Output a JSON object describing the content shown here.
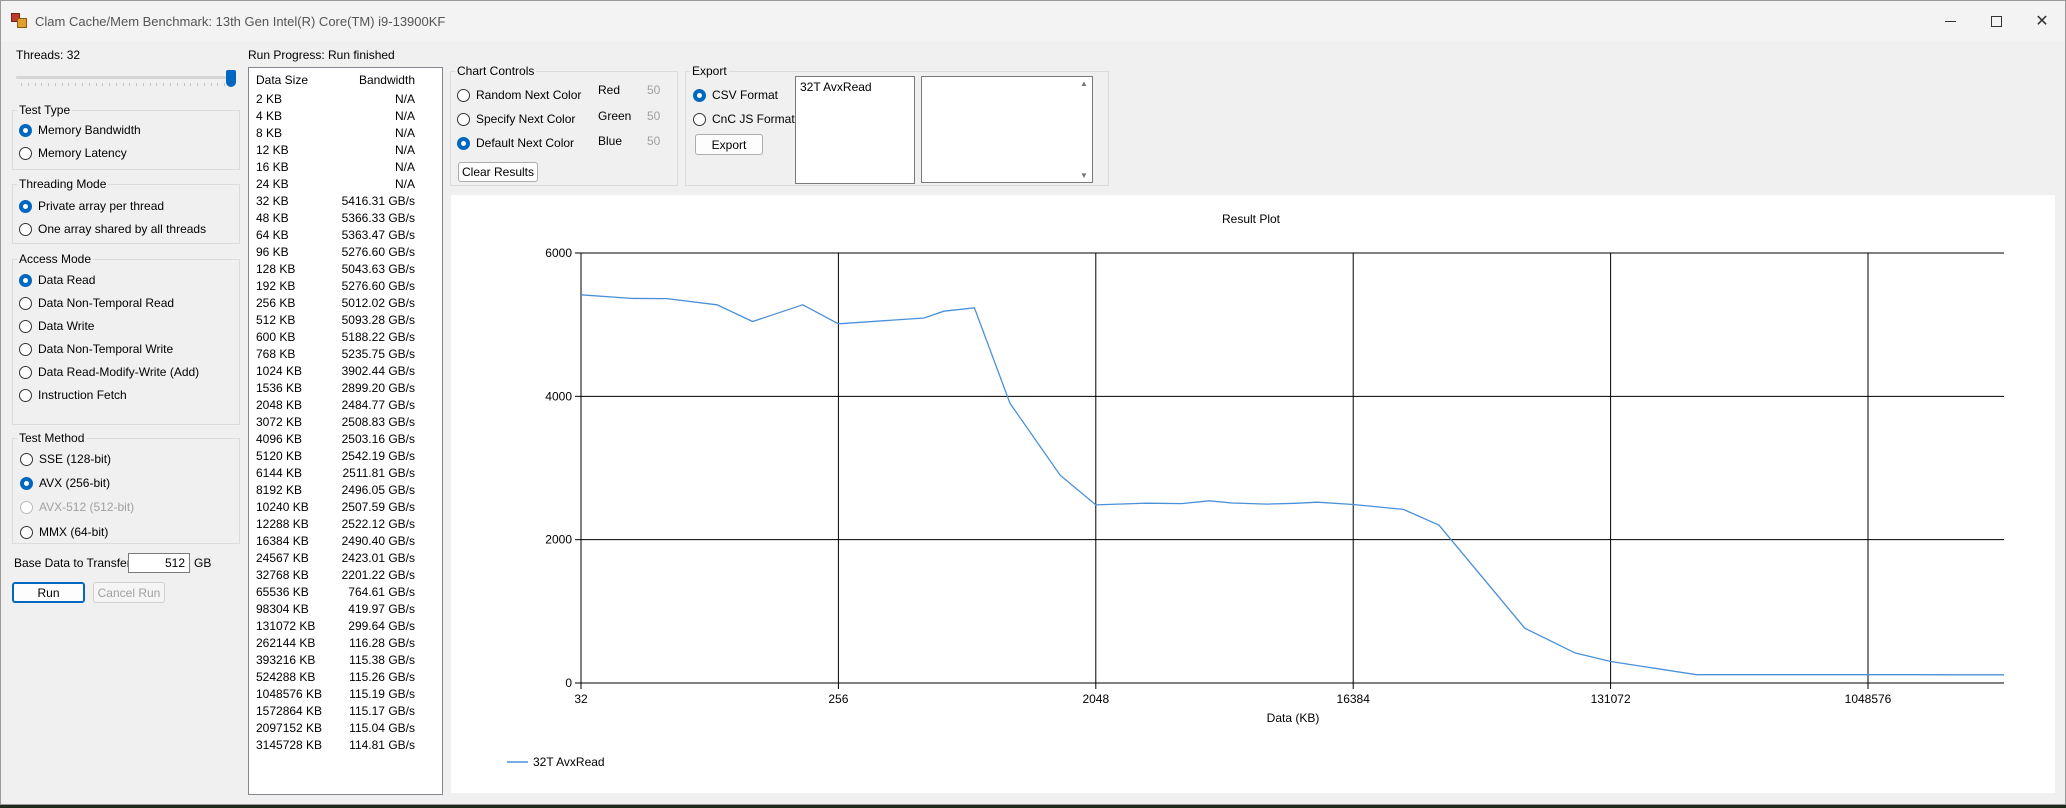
{
  "window": {
    "title": "Clam Cache/Mem Benchmark: 13th Gen Intel(R) Core(TM) i9-13900KF"
  },
  "threads": {
    "label": "Threads: 32",
    "slider_fraction": 1.0
  },
  "test_type": {
    "title": "Test Type",
    "options": [
      "Memory Bandwidth",
      "Memory Latency"
    ],
    "selected": 0
  },
  "threading_mode": {
    "title": "Threading Mode",
    "options": [
      "Private array per thread",
      "One array shared by all threads"
    ],
    "selected": 0
  },
  "access_mode": {
    "title": "Access Mode",
    "options": [
      "Data Read",
      "Data Non-Temporal Read",
      "Data Write",
      "Data Non-Temporal Write",
      "Data Read-Modify-Write (Add)",
      "Instruction Fetch"
    ],
    "selected": 0
  },
  "test_method": {
    "title": "Test Method",
    "options": [
      "SSE (128-bit)",
      "AVX (256-bit)",
      "AVX-512 (512-bit)",
      "MMX (64-bit)"
    ],
    "selected": 1,
    "disabled": 2
  },
  "base_data": {
    "label": "Base Data to Transfer:",
    "value": "512",
    "unit": "GB"
  },
  "buttons": {
    "run": "Run",
    "cancel": "Cancel Run",
    "clear": "Clear Results",
    "export": "Export"
  },
  "progress": {
    "label": "Run Progress:",
    "status": "Run finished"
  },
  "results": {
    "headers": [
      "Data Size",
      "Bandwidth"
    ],
    "rows": [
      [
        "2 KB",
        "N/A"
      ],
      [
        "4 KB",
        "N/A"
      ],
      [
        "8 KB",
        "N/A"
      ],
      [
        "12 KB",
        "N/A"
      ],
      [
        "16 KB",
        "N/A"
      ],
      [
        "24 KB",
        "N/A"
      ],
      [
        "32 KB",
        "5416.31 GB/s"
      ],
      [
        "48 KB",
        "5366.33 GB/s"
      ],
      [
        "64 KB",
        "5363.47 GB/s"
      ],
      [
        "96 KB",
        "5276.60 GB/s"
      ],
      [
        "128 KB",
        "5043.63 GB/s"
      ],
      [
        "192 KB",
        "5276.60 GB/s"
      ],
      [
        "256 KB",
        "5012.02 GB/s"
      ],
      [
        "512 KB",
        "5093.28 GB/s"
      ],
      [
        "600 KB",
        "5188.22 GB/s"
      ],
      [
        "768 KB",
        "5235.75 GB/s"
      ],
      [
        "1024 KB",
        "3902.44 GB/s"
      ],
      [
        "1536 KB",
        "2899.20 GB/s"
      ],
      [
        "2048 KB",
        "2484.77 GB/s"
      ],
      [
        "3072 KB",
        "2508.83 GB/s"
      ],
      [
        "4096 KB",
        "2503.16 GB/s"
      ],
      [
        "5120 KB",
        "2542.19 GB/s"
      ],
      [
        "6144 KB",
        "2511.81 GB/s"
      ],
      [
        "8192 KB",
        "2496.05 GB/s"
      ],
      [
        "10240 KB",
        "2507.59 GB/s"
      ],
      [
        "12288 KB",
        "2522.12 GB/s"
      ],
      [
        "16384 KB",
        "2490.40 GB/s"
      ],
      [
        "24567 KB",
        "2423.01 GB/s"
      ],
      [
        "32768 KB",
        "2201.22 GB/s"
      ],
      [
        "65536 KB",
        "764.61 GB/s"
      ],
      [
        "98304 KB",
        "419.97 GB/s"
      ],
      [
        "131072 KB",
        "299.64 GB/s"
      ],
      [
        "262144 KB",
        "116.28 GB/s"
      ],
      [
        "393216 KB",
        "115.38 GB/s"
      ],
      [
        "524288 KB",
        "115.26 GB/s"
      ],
      [
        "1048576 KB",
        "115.19 GB/s"
      ],
      [
        "1572864 KB",
        "115.17 GB/s"
      ],
      [
        "2097152 KB",
        "115.04 GB/s"
      ],
      [
        "3145728 KB",
        "114.81 GB/s"
      ]
    ]
  },
  "chart_controls": {
    "title": "Chart Controls",
    "options": [
      "Random Next Color",
      "Specify Next Color",
      "Default Next Color"
    ],
    "selected": 2,
    "rgb": [
      {
        "label": "Red",
        "value": "50"
      },
      {
        "label": "Green",
        "value": "50"
      },
      {
        "label": "Blue",
        "value": "50"
      }
    ]
  },
  "export": {
    "title": "Export",
    "options": [
      "CSV Format",
      "CnC JS Format"
    ],
    "selected": 0,
    "textbox": "32T AvxRead"
  },
  "colors": {
    "series": "#4a90d9",
    "accent": "#0067c0"
  },
  "chart_data": {
    "type": "line",
    "title": "Result Plot",
    "xlabel": "Data (KB)",
    "ylabel": "",
    "x_scale": "log2",
    "xlim": [
      32,
      3145728
    ],
    "ylim": [
      0,
      6000
    ],
    "x_ticks": [
      32,
      256,
      2048,
      16384,
      131072,
      1048576
    ],
    "y_ticks": [
      0,
      2000,
      4000,
      6000
    ],
    "grid": true,
    "legend": "bottom-left",
    "series": [
      {
        "name": "32T AvxRead",
        "x": [
          32,
          48,
          64,
          96,
          128,
          192,
          256,
          512,
          600,
          768,
          1024,
          1536,
          2048,
          3072,
          4096,
          5120,
          6144,
          8192,
          10240,
          12288,
          16384,
          24567,
          32768,
          65536,
          98304,
          131072,
          262144,
          393216,
          524288,
          1048576,
          1572864,
          2097152,
          3145728
        ],
        "y": [
          5416.31,
          5366.33,
          5363.47,
          5276.6,
          5043.63,
          5276.6,
          5012.02,
          5093.28,
          5188.22,
          5235.75,
          3902.44,
          2899.2,
          2484.77,
          2508.83,
          2503.16,
          2542.19,
          2511.81,
          2496.05,
          2507.59,
          2522.12,
          2490.4,
          2423.01,
          2201.22,
          764.61,
          419.97,
          299.64,
          116.28,
          115.38,
          115.26,
          115.19,
          115.17,
          115.04,
          114.81
        ]
      }
    ]
  }
}
